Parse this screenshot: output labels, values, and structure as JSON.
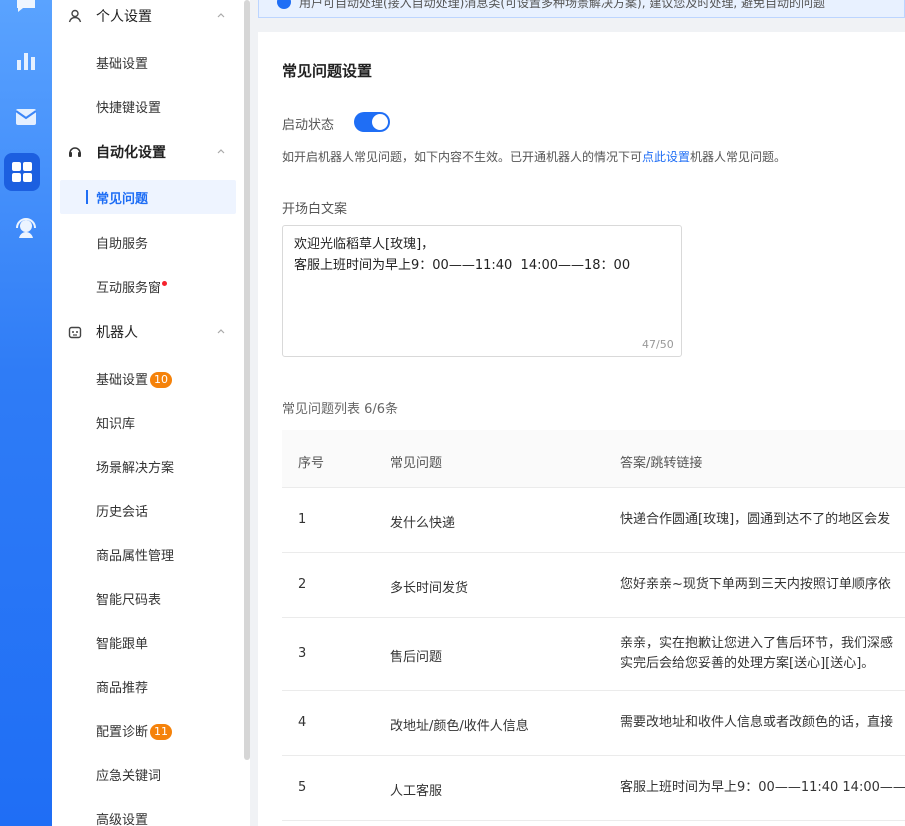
{
  "rail": {
    "icons": [
      "chat-icon",
      "bar-chart-icon",
      "mail-icon",
      "apps-grid-icon",
      "support-agent-icon"
    ]
  },
  "notice": {
    "text": "用户可自动处理(接入自动处理)消息类(可设置多种场景解决方案), 建议您及时处理, 避免自动的问题"
  },
  "sidebar": {
    "groups": [
      {
        "label": "个人设置",
        "items": [
          {
            "label": "基础设置"
          },
          {
            "label": "快捷键设置"
          }
        ]
      },
      {
        "label": "自动化设置",
        "items": [
          {
            "label": "常见问题"
          },
          {
            "label": "自助服务"
          },
          {
            "label": "互动服务窗"
          }
        ]
      },
      {
        "label": "机器人",
        "items": [
          {
            "label": "基础设置",
            "badge": "10"
          },
          {
            "label": "知识库"
          },
          {
            "label": "场景解决方案"
          },
          {
            "label": "历史会话"
          },
          {
            "label": "商品属性管理"
          },
          {
            "label": "智能尺码表"
          },
          {
            "label": "智能跟单"
          },
          {
            "label": "商品推荐"
          },
          {
            "label": "配置诊断",
            "badge": "11"
          },
          {
            "label": "应急关键词"
          },
          {
            "label": "高级设置"
          }
        ]
      }
    ]
  },
  "main": {
    "title": "常见问题设置",
    "status_label": "启动状态",
    "toggle_on": true,
    "hint_before": "如开启机器人常见问题，如下内容不生效。已开通机器人的情况下可",
    "hint_link": "点此设置",
    "hint_after": "机器人常见问题。",
    "opening_label": "开场白文案",
    "opening_text": "欢迎光临稻草人[玫瑰]，\n客服上班时间为早上9：00——11:40  14:00——18：00",
    "opening_counter": "47/50",
    "list_label": "常见问题列表 6/6条",
    "columns": [
      "序号",
      "常见问题",
      "答案/跳转链接"
    ],
    "rows": [
      {
        "index": "1",
        "question": "发什么快递",
        "answer": "快递合作圆通[玫瑰]，圆通到达不了的地区会发"
      },
      {
        "index": "2",
        "question": "多长时间发货",
        "answer": "您好亲亲~现货下单两到三天内按照订单顺序依"
      },
      {
        "index": "3",
        "question": "售后问题",
        "answer": "亲亲，实在抱歉让您进入了售后环节，我们深感\n实完后会给您妥善的处理方案[送心][送心]。"
      },
      {
        "index": "4",
        "question": "改地址/颜色/收件人信息",
        "answer": "需要改地址和收件人信息或者改颜色的话，直接"
      },
      {
        "index": "5",
        "question": "人工客服",
        "answer": "客服上班时间为早上9：00——11:40  14:00——"
      }
    ]
  }
}
